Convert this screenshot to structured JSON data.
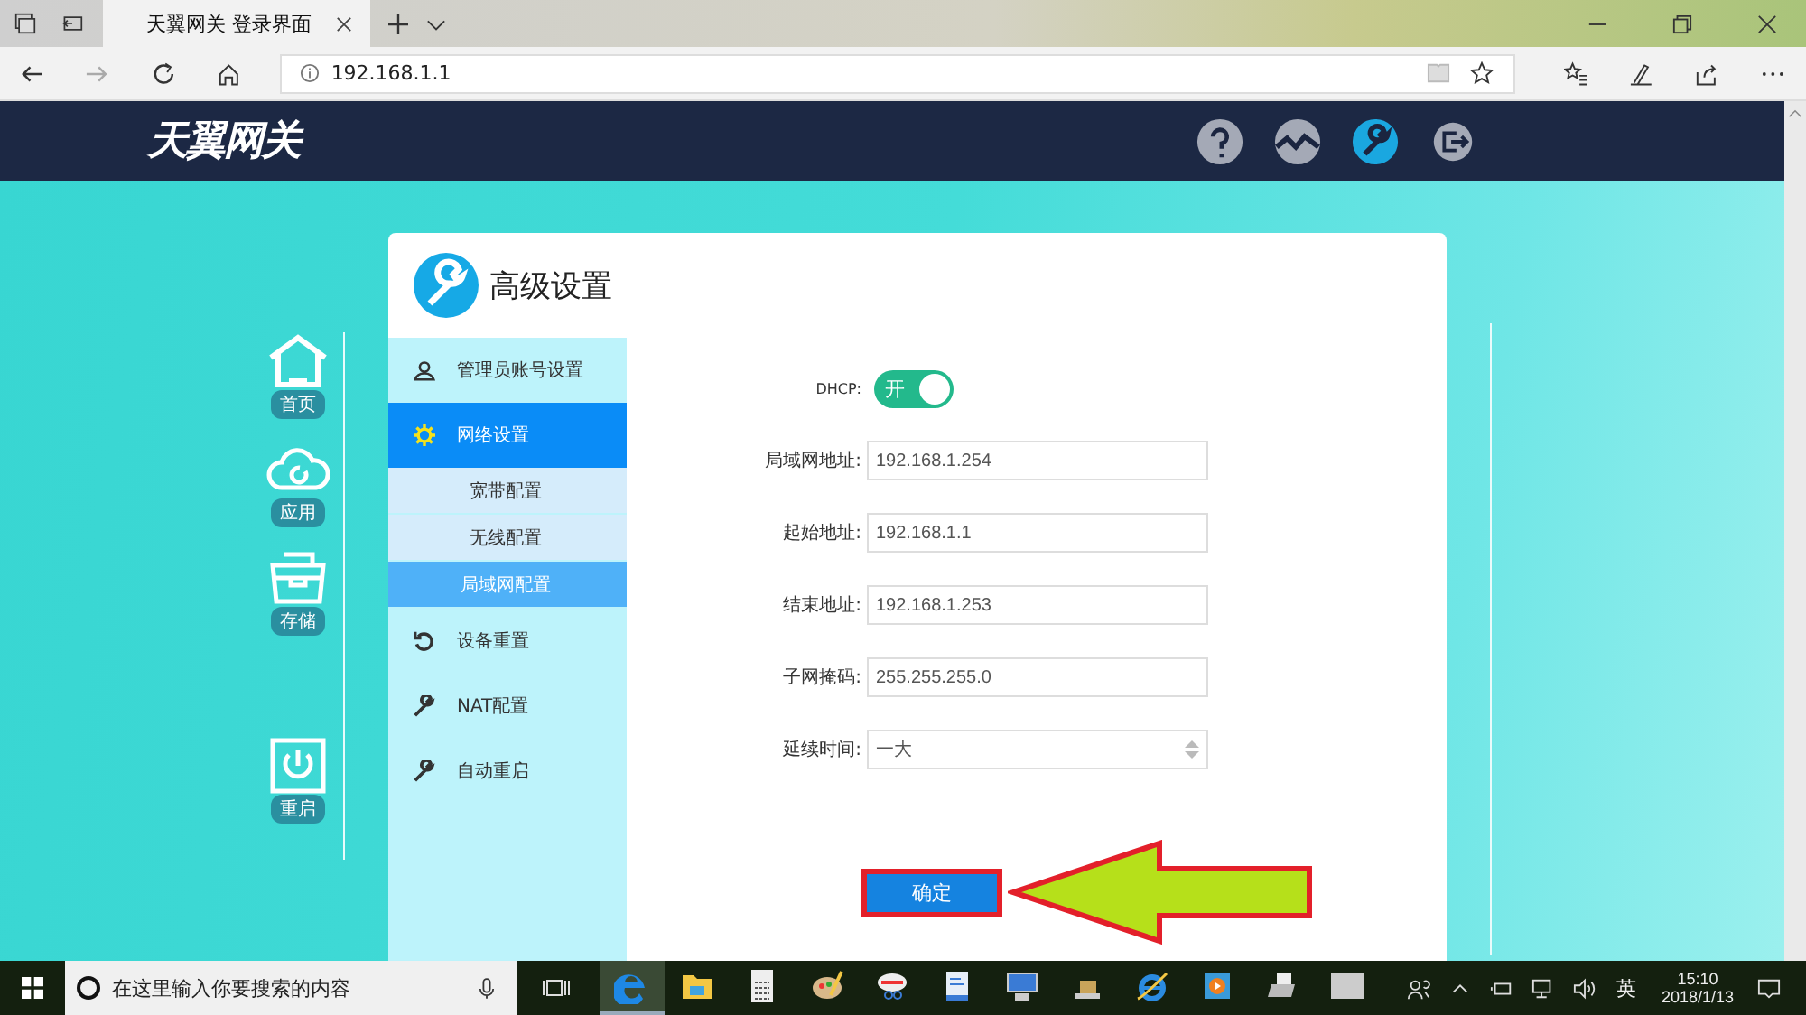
{
  "browser": {
    "tab_title": "天翼网关 登录界面",
    "address": "192.168.1.1"
  },
  "header": {
    "logo": "天翼网关",
    "nav": [
      {
        "kind": "help",
        "selected": false
      },
      {
        "kind": "status",
        "selected": false
      },
      {
        "kind": "settings",
        "selected": true
      },
      {
        "kind": "logout",
        "selected": false
      }
    ]
  },
  "side_nav": [
    {
      "kind": "home",
      "label": "首页"
    },
    {
      "kind": "cloud",
      "label": "应用"
    },
    {
      "kind": "storage",
      "label": "存储"
    },
    {
      "kind": "power",
      "label": "重启"
    }
  ],
  "panel": {
    "title": "高级设置",
    "menu": [
      {
        "kind": "user",
        "label": "管理员账号设置",
        "selected": false
      },
      {
        "kind": "gear",
        "label": "网络设置",
        "selected": true,
        "children": [
          {
            "label": "宽带配置",
            "selected": false
          },
          {
            "label": "无线配置",
            "selected": false
          },
          {
            "label": "局域网配置",
            "selected": true
          }
        ]
      },
      {
        "kind": "reset",
        "label": "设备重置",
        "selected": false
      },
      {
        "kind": "wrench",
        "label": "NAT配置",
        "selected": false
      },
      {
        "kind": "wrench",
        "label": "自动重启",
        "selected": false
      }
    ],
    "dhcp": {
      "label": "DHCP:",
      "on": true,
      "state_text": "开"
    },
    "fields": [
      {
        "kind": "text",
        "label": "局域网地址:",
        "value": "192.168.1.254"
      },
      {
        "kind": "text",
        "label": "起始地址:",
        "value": "192.168.1.1"
      },
      {
        "kind": "text",
        "label": "结束地址:",
        "value": "192.168.1.253"
      },
      {
        "kind": "text",
        "label": "子网掩码:",
        "value": "255.255.255.0"
      },
      {
        "kind": "select",
        "label": "延续时间:",
        "value": "一大"
      }
    ],
    "submit": "确定"
  },
  "taskbar": {
    "search_placeholder": "在这里输入你要搜索的内容",
    "apps": [
      {
        "kind": "edge",
        "active": true
      },
      {
        "kind": "folder",
        "active": false
      },
      {
        "kind": "calculator",
        "active": false
      },
      {
        "kind": "paint",
        "active": false
      },
      {
        "kind": "snip",
        "active": false
      },
      {
        "kind": "doc",
        "active": false
      },
      {
        "kind": "computer",
        "active": false
      },
      {
        "kind": "scanner",
        "active": false
      },
      {
        "kind": "ie",
        "active": false
      },
      {
        "kind": "media",
        "active": false
      },
      {
        "kind": "printer",
        "active": false
      },
      {
        "kind": "blank",
        "active": false
      }
    ],
    "ime": "英",
    "time": "15:10",
    "date": "2018/1/13"
  }
}
